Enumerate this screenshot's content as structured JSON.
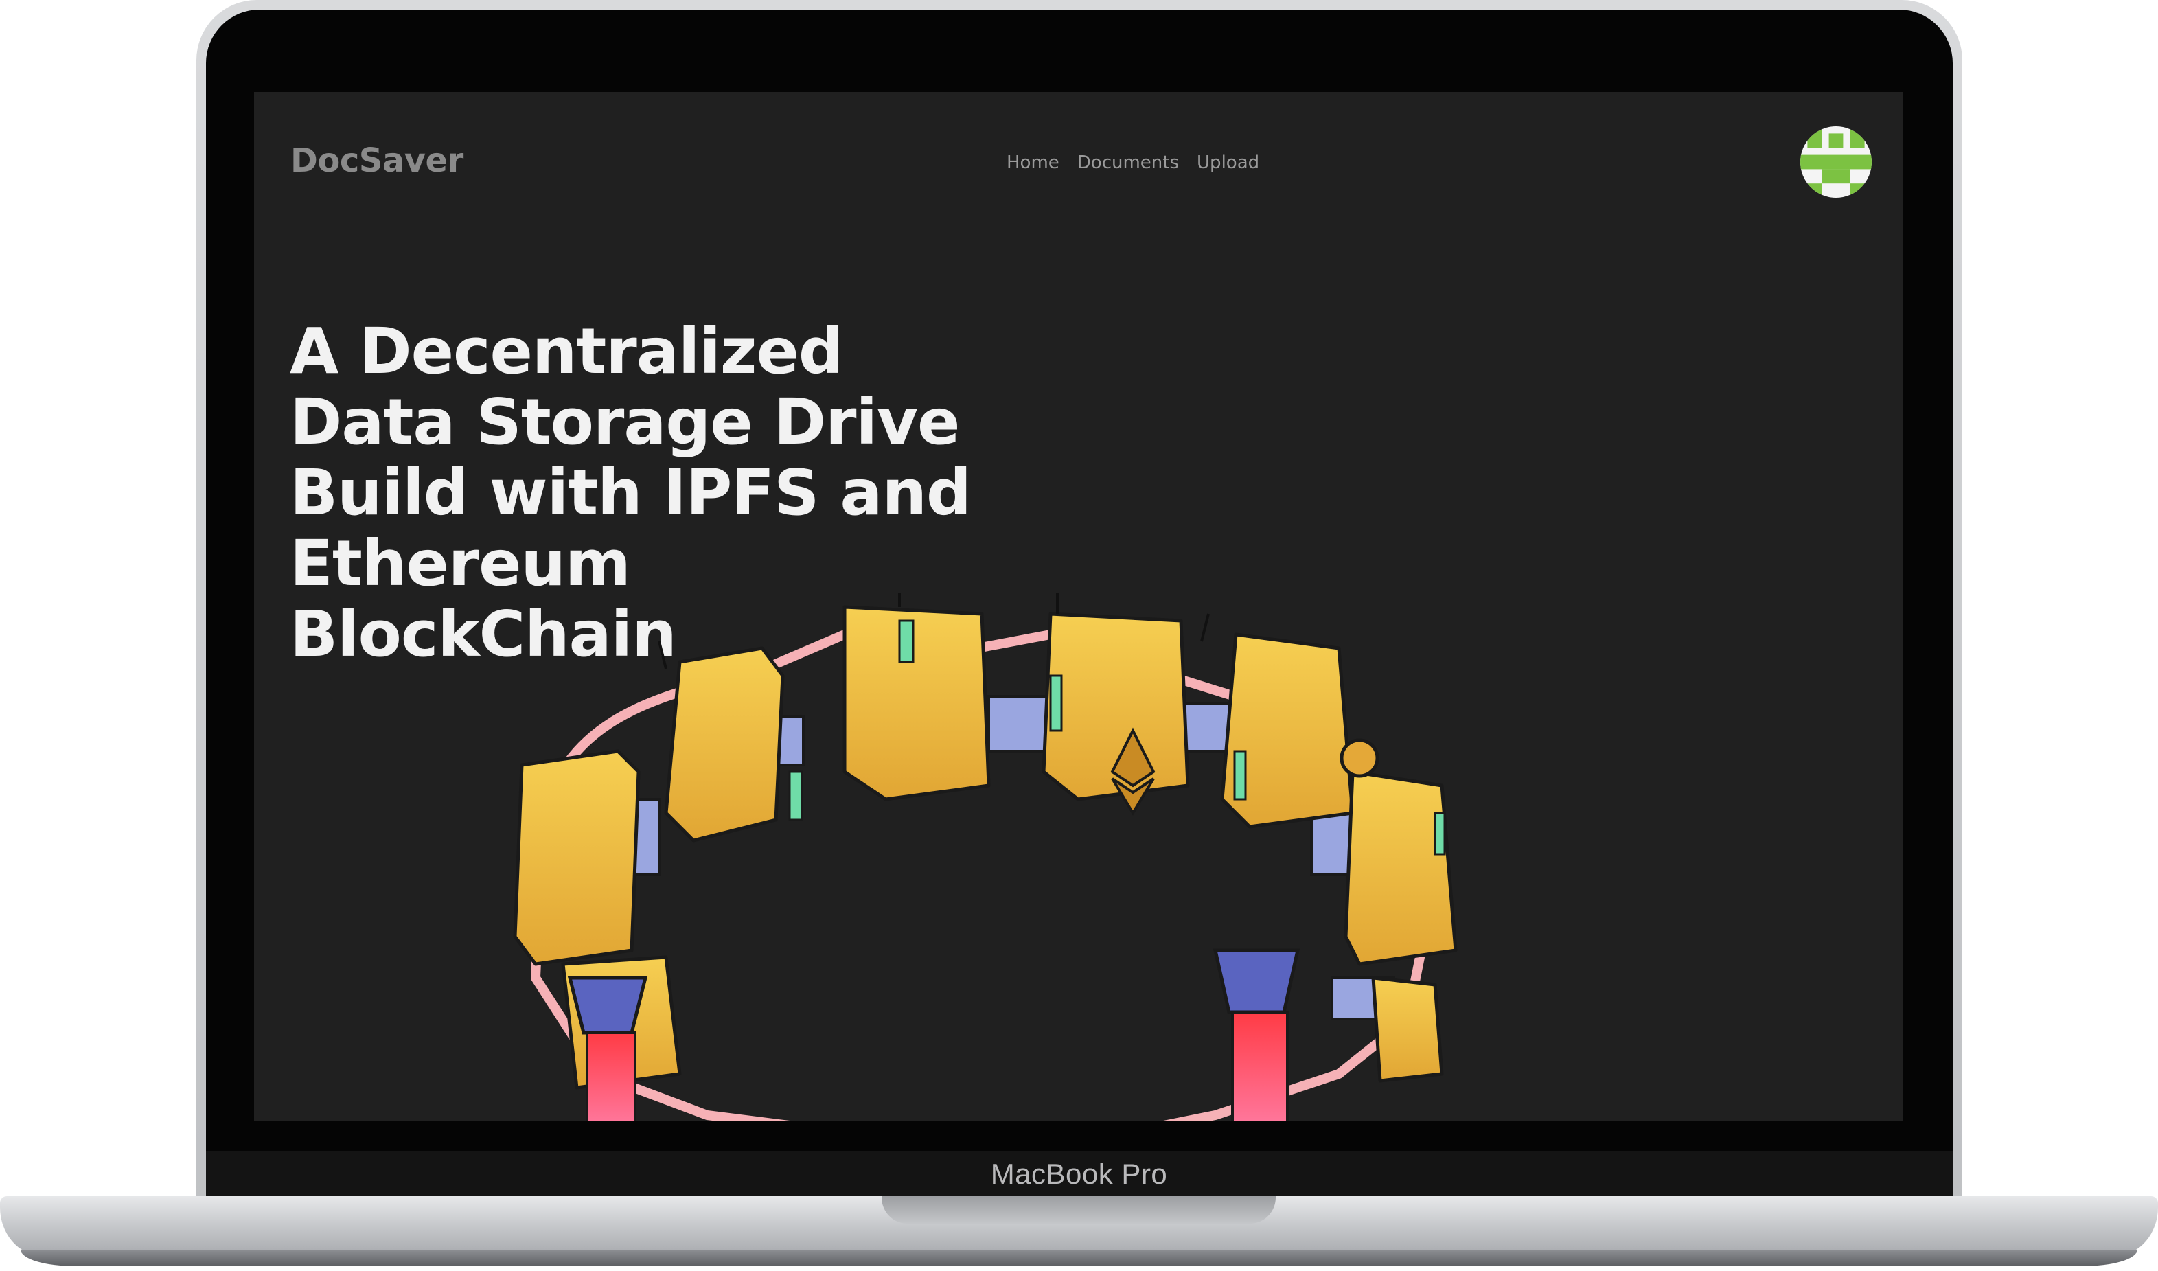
{
  "device": {
    "model_label": "MacBook Pro"
  },
  "app": {
    "logo_text": "DocSaver",
    "nav": [
      {
        "label": "Home"
      },
      {
        "label": "Documents"
      },
      {
        "label": "Upload"
      }
    ],
    "avatar_icon": "identicon-avatar",
    "hero": {
      "title_lines": [
        "A Decentralized",
        "Data Storage Drive",
        "Build with IPFS and",
        "Ethereum",
        "BlockChain"
      ]
    },
    "illustration_icon": "blockchain-ring-illustration",
    "colors": {
      "background": "#202020",
      "block_yellow": "#f2c443",
      "block_shadow": "#d79a2b",
      "connector_blue": "#9aa6e0",
      "glow_red": "#ff4a5a",
      "outline_pink": "#f6b1b6",
      "avatar_green": "#7cc242"
    }
  }
}
